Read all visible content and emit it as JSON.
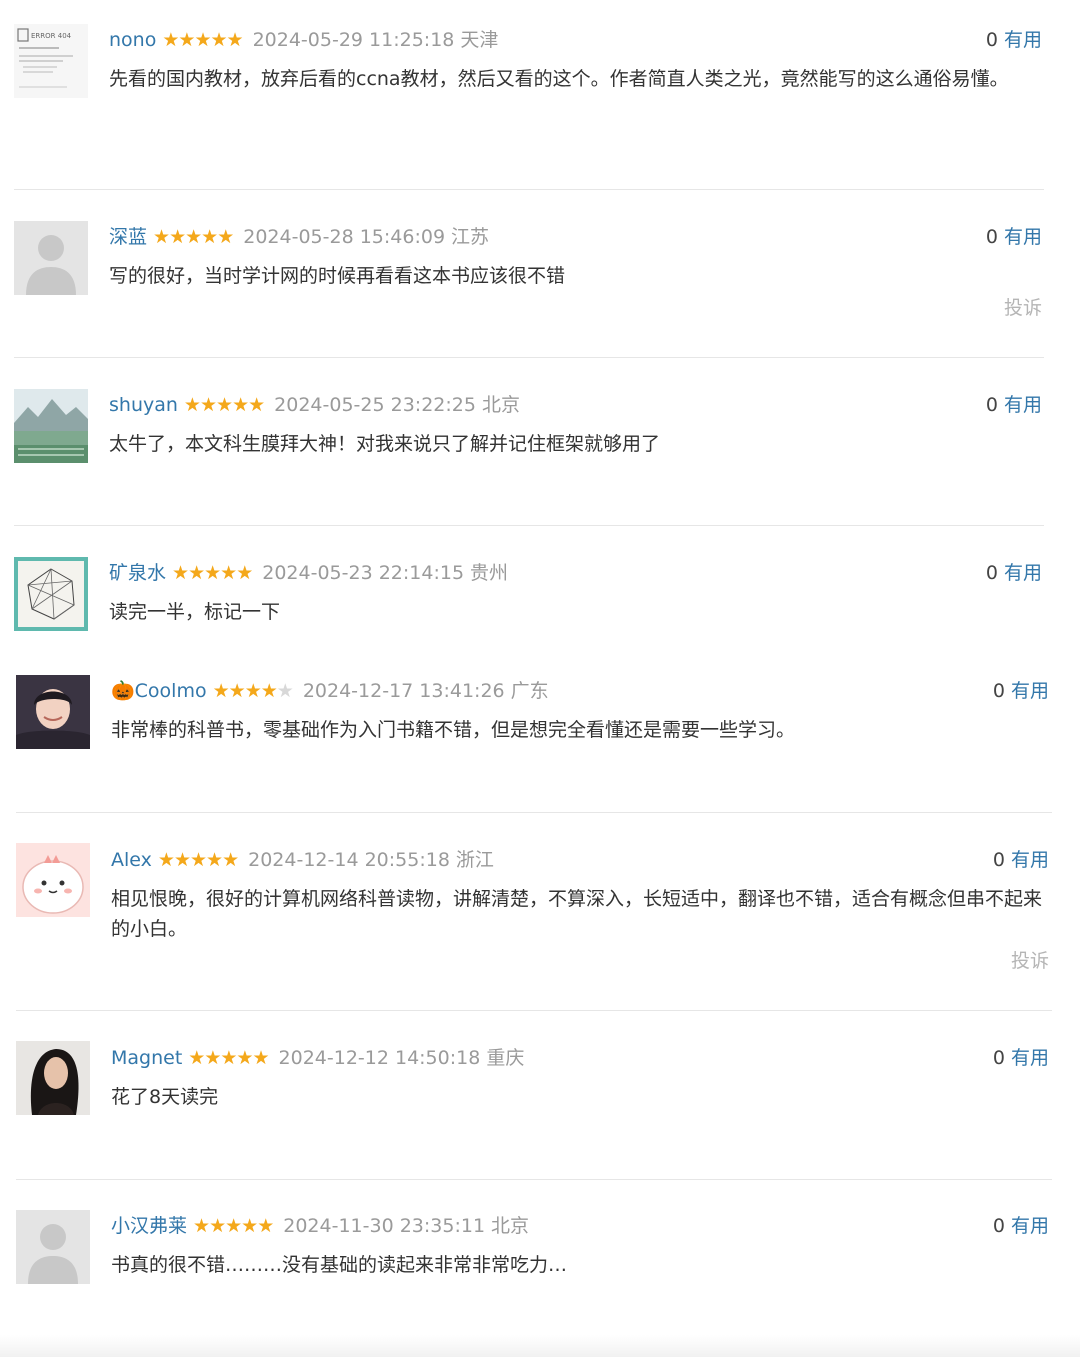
{
  "reviews": [
    {
      "name": "nono",
      "stars": 5,
      "date": "2024-05-29 11:25:18",
      "location": "天津",
      "useful_count": "0",
      "useful_label": "有用",
      "text": "先看的国内教材，放弃后看的ccna教材，然后又看的这个。作者简直人类之光，竟然能写的这么通俗易懂。",
      "report": "",
      "avatar": {
        "text": "ERROR 404"
      }
    },
    {
      "name": "深蓝",
      "stars": 5,
      "date": "2024-05-28 15:46:09",
      "location": "江苏",
      "useful_count": "0",
      "useful_label": "有用",
      "text": "写的很好，当时学计网的时候再看看这本书应该很不错",
      "report": "投诉"
    },
    {
      "name": "shuyan",
      "stars": 5,
      "date": "2024-05-25 23:22:25",
      "location": "北京",
      "useful_count": "0",
      "useful_label": "有用",
      "text": "太牛了，本文科生膜拜大神！对我来说只了解并记住框架就够用了",
      "report": ""
    },
    {
      "name": "矿泉水",
      "stars": 5,
      "date": "2024-05-23 22:14:15",
      "location": "贵州",
      "useful_count": "0",
      "useful_label": "有用",
      "text": "读完一半，标记一下",
      "report": ""
    },
    {
      "name": "🎃Coolmo",
      "stars": 4,
      "date": "2024-12-17 13:41:26",
      "location": "广东",
      "useful_count": "0",
      "useful_label": "有用",
      "text": "非常棒的科普书，零基础作为入门书籍不错，但是想完全看懂还是需要一些学习。",
      "report": ""
    },
    {
      "name": "Alex",
      "stars": 5,
      "date": "2024-12-14 20:55:18",
      "location": "浙江",
      "useful_count": "0",
      "useful_label": "有用",
      "text": "相见恨晚，很好的计算机网络科普读物，讲解清楚，不算深入，长短适中，翻译也不错，适合有概念但串不起来的小白。",
      "report": "投诉"
    },
    {
      "name": "Magnet",
      "stars": 5,
      "date": "2024-12-12 14:50:18",
      "location": "重庆",
      "useful_count": "0",
      "useful_label": "有用",
      "text": "花了8天读完",
      "report": ""
    },
    {
      "name": "小汉弗莱",
      "stars": 5,
      "date": "2024-11-30 23:35:11",
      "location": "北京",
      "useful_count": "0",
      "useful_label": "有用",
      "text": "书真的很不错………没有基础的读起来非常非常吃力…",
      "report": ""
    }
  ],
  "colors": {
    "link": "#3377aa",
    "star": "#f4a81b",
    "muted": "#9a9a9a"
  },
  "icons": {
    "star": "star-icon",
    "default_avatar": "person-silhouette-icon"
  }
}
